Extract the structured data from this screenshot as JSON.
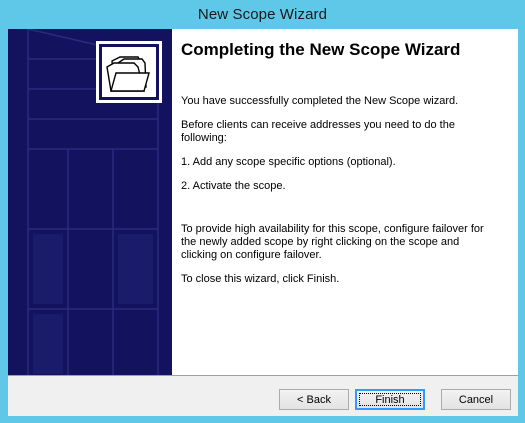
{
  "window": {
    "title": "New Scope Wizard"
  },
  "wizard": {
    "heading": "Completing the New Scope Wizard",
    "paragraphs": {
      "success": "You have successfully completed the New Scope wizard.",
      "before": "Before clients can receive addresses you need to do the following:",
      "step1": "1. Add any scope specific options (optional).",
      "step2": "2. Activate the scope.",
      "failover": "To provide high availability for this scope, configure failover for the newly added scope by right clicking on the scope and clicking on configure failover.",
      "close": "To close this wizard, click Finish."
    },
    "icon": "folders-icon"
  },
  "buttons": {
    "back": "< Back",
    "finish": "Finish",
    "cancel": "Cancel"
  },
  "colors": {
    "titlebar": "#5fc8e8",
    "banner": "#12125e",
    "accent": "#3399ff"
  }
}
